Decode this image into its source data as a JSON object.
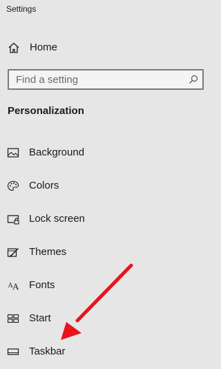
{
  "window": {
    "title": "Settings"
  },
  "home": {
    "label": "Home",
    "icon": "home-icon"
  },
  "search": {
    "placeholder": "Find a setting",
    "icon": "search-icon"
  },
  "section": {
    "title": "Personalization"
  },
  "nav": {
    "items": [
      {
        "label": "Background",
        "icon": "picture-icon"
      },
      {
        "label": "Colors",
        "icon": "palette-icon"
      },
      {
        "label": "Lock screen",
        "icon": "lock-screen-icon"
      },
      {
        "label": "Themes",
        "icon": "themes-icon"
      },
      {
        "label": "Fonts",
        "icon": "fonts-icon"
      },
      {
        "label": "Start",
        "icon": "start-icon"
      },
      {
        "label": "Taskbar",
        "icon": "taskbar-icon"
      }
    ]
  },
  "annotation": {
    "color": "#e8141b",
    "target": "Taskbar"
  }
}
